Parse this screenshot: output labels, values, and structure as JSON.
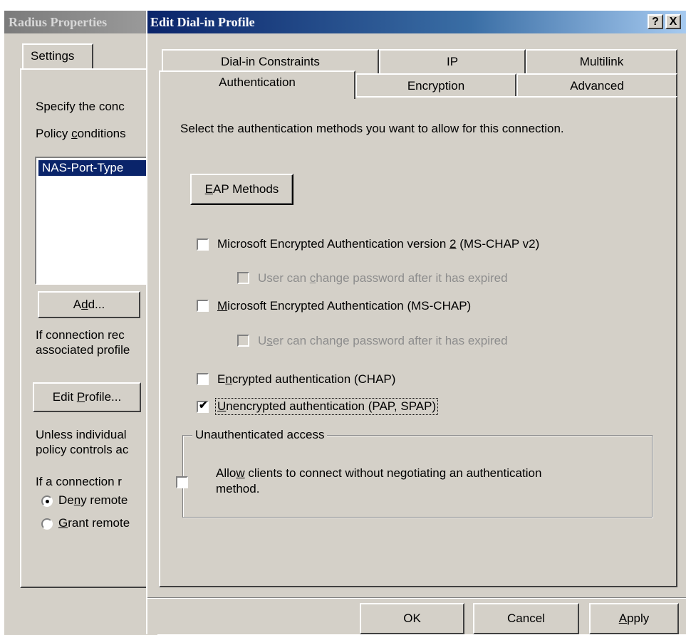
{
  "back_window": {
    "title": "Radius Properties",
    "tab_label": "Settings",
    "specify_text": "Specify the conc",
    "policy_conditions_pre": "Policy ",
    "policy_conditions_u": "c",
    "policy_conditions_post": "onditions",
    "policy_item": "NAS-Port-Type",
    "add_pre": "A",
    "add_u": "d",
    "add_post": "d...",
    "if_line1": "If connection rec",
    "if_line2": "associated profile",
    "edit_pre": "Edit ",
    "edit_u": "P",
    "edit_post": "rofile...",
    "unless_line1": "Unless individual",
    "unless_line2": "policy controls ac",
    "if_conn": "If a connection r",
    "radio_deny_pre": "De",
    "radio_deny_u": "n",
    "radio_deny_post": "y remote",
    "radio_grant_u": "G",
    "radio_grant_post": "rant remote",
    "deny_selected": true
  },
  "dialog": {
    "title": "Edit Dial-in Profile",
    "help_button": "?",
    "close_button": "X",
    "tabs_row1": [
      "Dial-in Constraints",
      "IP",
      "Multilink"
    ],
    "tabs_row2": [
      "Authentication",
      "Encryption",
      "Advanced"
    ],
    "active_tab": "Authentication",
    "instruction": "Select the authentication methods you want to allow for this connection.",
    "eap_pre": "",
    "eap_u": "E",
    "eap_post": "AP Methods",
    "mschapv2_pre": "Microsoft Encrypted Authentication version ",
    "mschapv2_u": "2",
    "mschapv2_post": " (MS-CHAP v2)",
    "mschapv2_checked": false,
    "mschapv2_pw_pre": "User can ",
    "mschapv2_pw_u": "c",
    "mschapv2_pw_post": "hange password after it has expired",
    "mschap_pre": "",
    "mschap_u": "M",
    "mschap_post": "icrosoft Encrypted Authentication (MS-CHAP)",
    "mschap_checked": false,
    "mschap_pw_pre": "U",
    "mschap_pw_u": "s",
    "mschap_pw_post": "er can change password after it has expired",
    "chap_pre": "E",
    "chap_u": "n",
    "chap_post": "crypted authentication (CHAP)",
    "chap_checked": false,
    "pap_pre": "",
    "pap_u": "U",
    "pap_post": "nencrypted authentication (PAP, SPAP)",
    "pap_checked": true,
    "group_title": "Unauthenticated access",
    "allow_pre": "Allo",
    "allow_u": "w",
    "allow_post": " clients to connect without negotiating an authentication",
    "allow_line2": "method.",
    "allow_checked": false,
    "ok_label": "OK",
    "cancel_label": "Cancel",
    "apply_u": "A",
    "apply_post": "pply"
  }
}
